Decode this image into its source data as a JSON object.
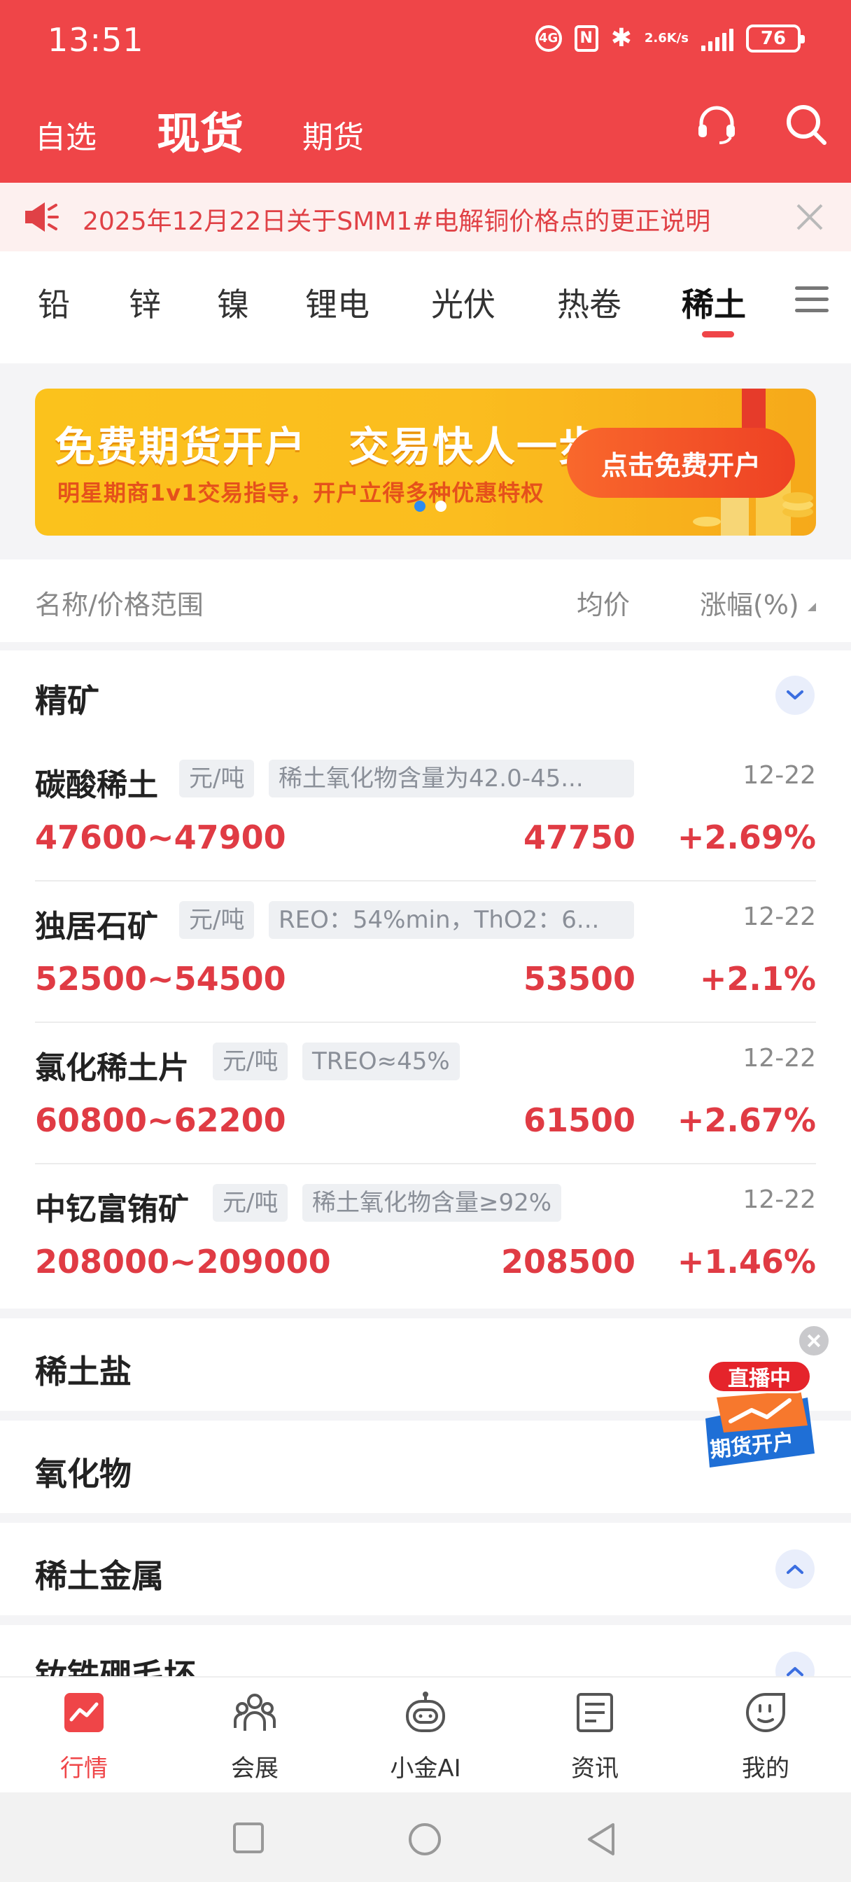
{
  "status_bar": {
    "time": "13:51",
    "net_speed_value": "2.6",
    "net_speed_unit": "K/s",
    "battery": "76",
    "icons": [
      "hd-icon",
      "nfc-icon",
      "bluetooth-icon",
      "signal-icon",
      "battery-icon"
    ]
  },
  "header": {
    "tabs": [
      {
        "label": "自选",
        "active": false
      },
      {
        "label": "现货",
        "active": true
      },
      {
        "label": "期货",
        "active": false
      }
    ],
    "icons": [
      "headset-icon",
      "search-icon"
    ]
  },
  "notice": {
    "text": "2025年12月22日关于SMM1#电解铜价格点的更正说明"
  },
  "categories": [
    {
      "label": "铅",
      "active": false
    },
    {
      "label": "锌",
      "active": false
    },
    {
      "label": "镍",
      "active": false
    },
    {
      "label": "锂电",
      "active": false
    },
    {
      "label": "光伏",
      "active": false
    },
    {
      "label": "热卷",
      "active": false
    },
    {
      "label": "稀土",
      "active": true
    }
  ],
  "banner": {
    "title": "免费期货开户　交易快人一步",
    "subtitle": "明星期商1v1交易指导，开户立得多种优惠特权",
    "cta": "点击免费开户"
  },
  "list_header": {
    "name": "名称/价格范围",
    "avg": "均价",
    "change": "涨幅(%)"
  },
  "sections": {
    "concentrate": {
      "title": "精矿",
      "rows": [
        {
          "name": "碳酸稀土",
          "unit": "元/吨",
          "spec": "稀土氧化物含量为42.0-45...",
          "date": "12-22",
          "range": "47600~47900",
          "avg": "47750",
          "change": "+2.69%"
        },
        {
          "name": "独居石矿",
          "unit": "元/吨",
          "spec": "REO：54%min，ThO2：6...",
          "date": "12-22",
          "range": "52500~54500",
          "avg": "53500",
          "change": "+2.1%"
        },
        {
          "name": "氯化稀土片",
          "unit": "元/吨",
          "spec": "TREO≈45%",
          "date": "12-22",
          "range": "60800~62200",
          "avg": "61500",
          "change": "+2.67%"
        },
        {
          "name": "中钇富铕矿",
          "unit": "元/吨",
          "spec": "稀土氧化物含量≥92%",
          "date": "12-22",
          "range": "208000~209000",
          "avg": "208500",
          "change": "+1.46%"
        }
      ]
    },
    "salt": {
      "title": "稀土盐"
    },
    "oxide": {
      "title": "氧化物"
    },
    "metal": {
      "title": "稀土金属"
    },
    "ndfeb": {
      "title": "钕铁硼毛坯"
    }
  },
  "live_widget": {
    "badge": "直播中",
    "label": "期货开户"
  },
  "tabbar": [
    {
      "label": "行情",
      "icon": "chart-icon",
      "active": true
    },
    {
      "label": "会展",
      "icon": "people-icon",
      "active": false
    },
    {
      "label": "小金AI",
      "icon": "robot-icon",
      "active": false
    },
    {
      "label": "资讯",
      "icon": "document-icon",
      "active": false
    },
    {
      "label": "我的",
      "icon": "profile-icon",
      "active": false
    }
  ],
  "colors": {
    "brand_red": "#ef4548",
    "price_red": "#e03b44",
    "banner_yellow": "#fbc21c"
  }
}
